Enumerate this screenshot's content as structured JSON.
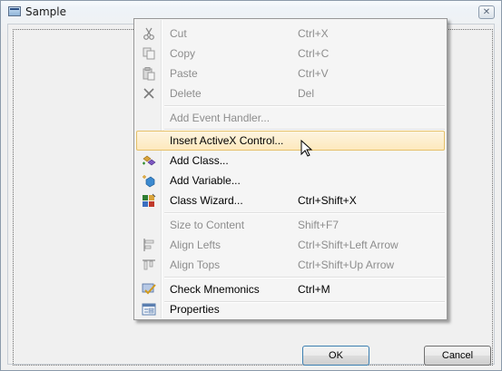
{
  "window": {
    "title": "Sample",
    "close_glyph": "✕"
  },
  "dialog": {
    "ok_label": "OK",
    "cancel_label": "Cancel"
  },
  "menu": {
    "items": [
      {
        "label": "Cut",
        "shortcut": "Ctrl+X",
        "icon": "scissors-icon",
        "enabled": false
      },
      {
        "label": "Copy",
        "shortcut": "Ctrl+C",
        "icon": "copy-icon",
        "enabled": false
      },
      {
        "label": "Paste",
        "shortcut": "Ctrl+V",
        "icon": "paste-icon",
        "enabled": false
      },
      {
        "label": "Delete",
        "shortcut": "Del",
        "icon": "delete-x-icon",
        "enabled": false
      },
      {
        "label": "Add Event Handler...",
        "shortcut": "",
        "icon": "",
        "enabled": false
      },
      {
        "label": "Insert ActiveX Control...",
        "shortcut": "",
        "icon": "",
        "enabled": true,
        "highlighted": true
      },
      {
        "label": "Add Class...",
        "shortcut": "",
        "icon": "add-class-icon",
        "enabled": true
      },
      {
        "label": "Add Variable...",
        "shortcut": "",
        "icon": "add-variable-icon",
        "enabled": true
      },
      {
        "label": "Class Wizard...",
        "shortcut": "Ctrl+Shift+X",
        "icon": "class-wizard-icon",
        "enabled": true
      },
      {
        "label": "Size to Content",
        "shortcut": "Shift+F7",
        "icon": "",
        "enabled": false
      },
      {
        "label": "Align Lefts",
        "shortcut": "Ctrl+Shift+Left Arrow",
        "icon": "align-lefts-icon",
        "enabled": false
      },
      {
        "label": "Align Tops",
        "shortcut": "Ctrl+Shift+Up Arrow",
        "icon": "align-tops-icon",
        "enabled": false
      },
      {
        "label": "Check Mnemonics",
        "shortcut": "Ctrl+M",
        "icon": "check-mnemonics-icon",
        "enabled": true
      },
      {
        "label": "Properties",
        "shortcut": "",
        "icon": "properties-icon",
        "enabled": true
      }
    ]
  },
  "colors": {
    "highlight_border": "#e6c16a",
    "disabled_text": "#8d8d8d",
    "accent": "#3c7fb1"
  }
}
